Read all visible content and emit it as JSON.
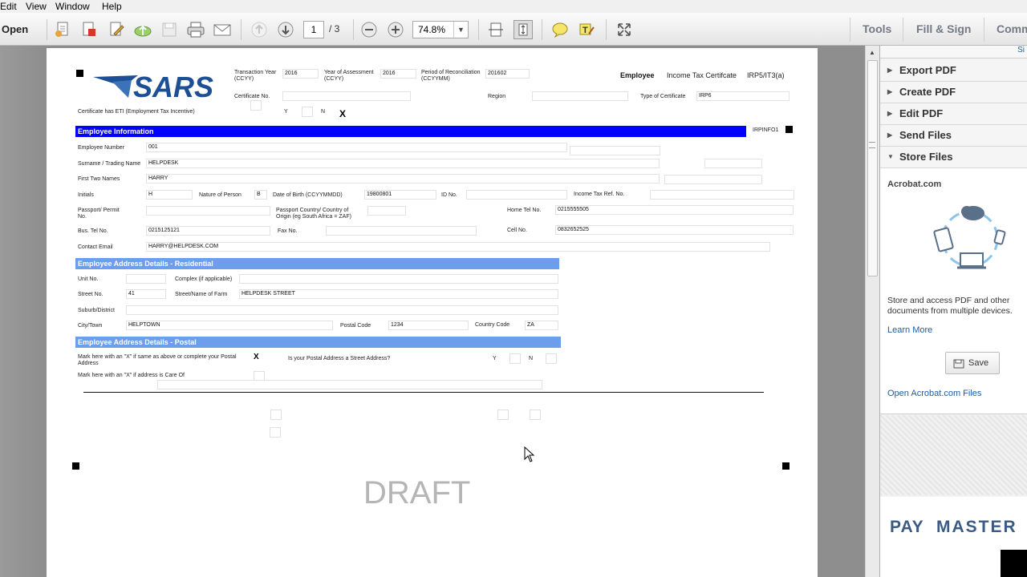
{
  "menu": [
    "Edit",
    "View",
    "Window",
    "Help"
  ],
  "toolbar": {
    "open_label": "Open",
    "page_current": "1",
    "page_total": "/ 3",
    "zoom": "74.8%",
    "tools_label": "Tools",
    "fill_sign_label": "Fill & Sign",
    "comment_label": "Comm"
  },
  "form": {
    "transaction_year_label": "Transaction Year (CCYY)",
    "transaction_year": "2016",
    "year_assessment_label": "Year of Assessment (CCYY)",
    "year_assessment": "2016",
    "period_recon_label": "Period of Reconciliation (CCYYMM)",
    "period_recon": "201602",
    "employee_label": "Employee",
    "income_tax_cert": "Income Tax Certifcate",
    "irp_code": "IRP5/IT3(a)",
    "cert_no_label": "Certificate No.",
    "region_label": "Region",
    "type_cert_label": "Type of Certificate",
    "type_cert": "IRP6",
    "eti_label": "Certificate has ETI (Employment Tax Incentive)",
    "y": "Y",
    "n": "N",
    "x": "X",
    "emp_info_title": "Employee Information",
    "irp_info_code": "IRPINFO1",
    "emp_number_label": "Employee Number",
    "emp_number": "001",
    "surname_label": "Surname / Trading Name",
    "surname": "HELPDESK",
    "first_names_label": "First Two Names",
    "first_names": "HARRY",
    "initials_label": "Initials",
    "initials": "H",
    "nature_label": "Nature of Person",
    "nature": "B",
    "dob_label": "Date of Birth (CCYYMMDD)",
    "dob": "19800801",
    "id_label": "ID No.",
    "income_tax_ref_label": "Income Tax Ref. No.",
    "passport_label": "Passport/ Permit No.",
    "passport_country_label": "Passport Country/ Country of Origin (eg South Africa = ZAF)",
    "home_tel_label": "Home Tel No.",
    "home_tel": "0215555505",
    "bus_tel_label": "Bus. Tel No.",
    "bus_tel": "0215125121",
    "fax_label": "Fax No.",
    "cell_label": "Cell No.",
    "cell": "0832652525",
    "email_label": "Contact Email",
    "email": "HARRY@HELPDESK.COM",
    "res_title": "Employee Address Details - Residential",
    "unit_label": "Unit No.",
    "complex_label": "Complex (if applicable)",
    "street_no_label": "Street No.",
    "street_no": "41",
    "street_name_label": "Street/Name of Farm",
    "street_name": "HELPDESK STREET",
    "suburb_label": "Suburb/District",
    "city_label": "City/Town",
    "city": "HELPTOWN",
    "postal_code_label": "Postal Code",
    "postal_code": "1234",
    "country_code_label": "Country Code",
    "country_code": "ZA",
    "postal_title": "Employee Address Details - Postal",
    "mark_same_label": "Mark here with an \"X\" if same as above or complete your Postal Address",
    "is_street_label": "Is your Postal Address a Street Address?",
    "care_of_label": "Mark here with an \"X\" if address is Care Of",
    "draft": "DRAFT"
  },
  "panel": {
    "top_text": "Si",
    "items": [
      "Export PDF",
      "Create PDF",
      "Edit PDF",
      "Send Files",
      "Store Files"
    ],
    "acrobat_title": "Acrobat.com",
    "store_desc": "Store and access PDF and other documents from multiple devices.",
    "learn_more": "Learn More",
    "save_label": "Save",
    "open_files": "Open Acrobat.com Files",
    "logo_text_a": "PAY",
    "logo_text_b": "MASTER"
  },
  "colors": {
    "band_dark": "#0000ff",
    "band_light": "#6d9eeb",
    "sars_blue": "#1c4f95",
    "link": "#1a5ea8",
    "paymaster": "#3a5b86"
  }
}
